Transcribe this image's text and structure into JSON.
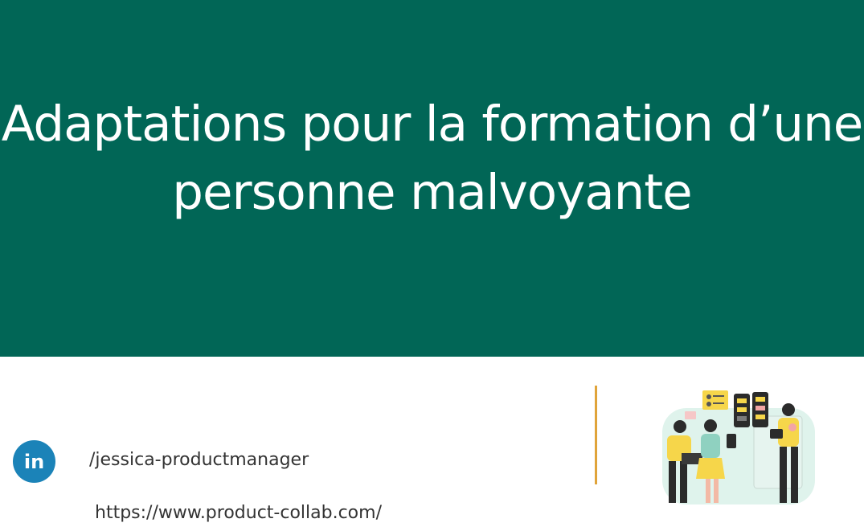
{
  "slide": {
    "title_line1": "Adaptations pour la formation d’une",
    "title_line2": "personne malvoyante"
  },
  "contact": {
    "linkedin_icon_text": "in",
    "linkedin_handle": "/jessica-productmanager",
    "website_url": "https://www.product-collab.com/"
  },
  "icons": {
    "linkedin": "linkedin-icon",
    "illustration": "team-collaboration-illustration"
  },
  "colors": {
    "banner": "#016656",
    "linkedin": "#1b83b8",
    "divider": "#e0a43a",
    "illustration_yellow": "#f6d64a",
    "illustration_mint": "#dff3ec"
  }
}
